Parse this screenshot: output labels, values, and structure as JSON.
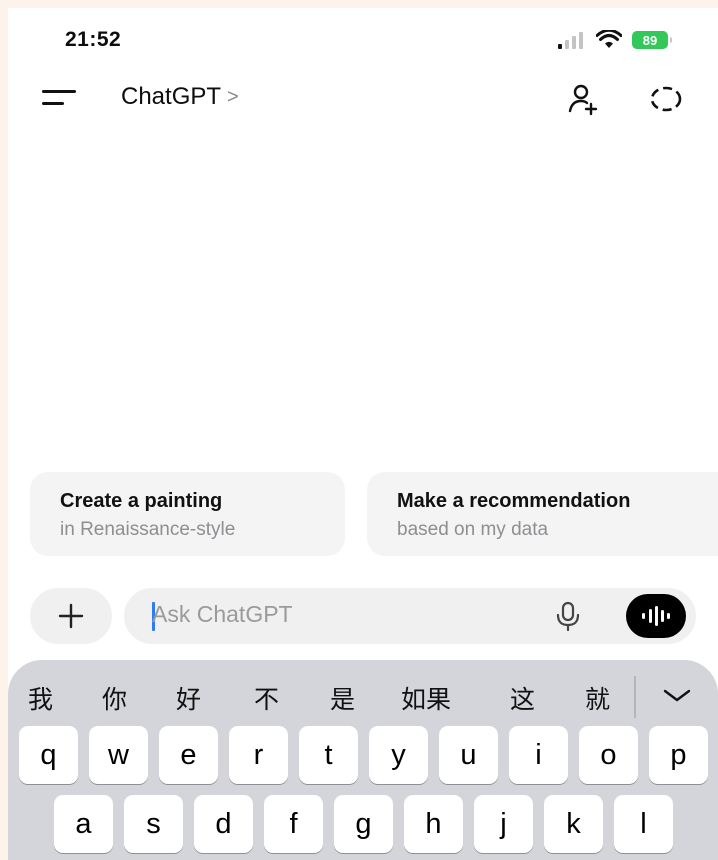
{
  "status_bar": {
    "time": "21:52",
    "battery": "89"
  },
  "header": {
    "title": "ChatGPT",
    "chevron": ">"
  },
  "suggestions": [
    {
      "title": "Create a painting",
      "subtitle": "in Renaissance-style"
    },
    {
      "title": "Make a recommendation",
      "subtitle": "based on my data"
    }
  ],
  "composer": {
    "placeholder": "Ask ChatGPT",
    "plus": "+"
  },
  "keyboard": {
    "candidates": [
      "我",
      "你",
      "好",
      "不",
      "是",
      "如果",
      "这",
      "就"
    ],
    "row1": [
      "q",
      "w",
      "e",
      "r",
      "t",
      "y",
      "u",
      "i",
      "o",
      "p"
    ],
    "row2": [
      "a",
      "s",
      "d",
      "f",
      "g",
      "h",
      "j",
      "k",
      "l"
    ]
  },
  "colors": {
    "accent_caret": "#2f7bf6",
    "battery": "#34c759",
    "keyboard_bg": "#d3d5db"
  }
}
